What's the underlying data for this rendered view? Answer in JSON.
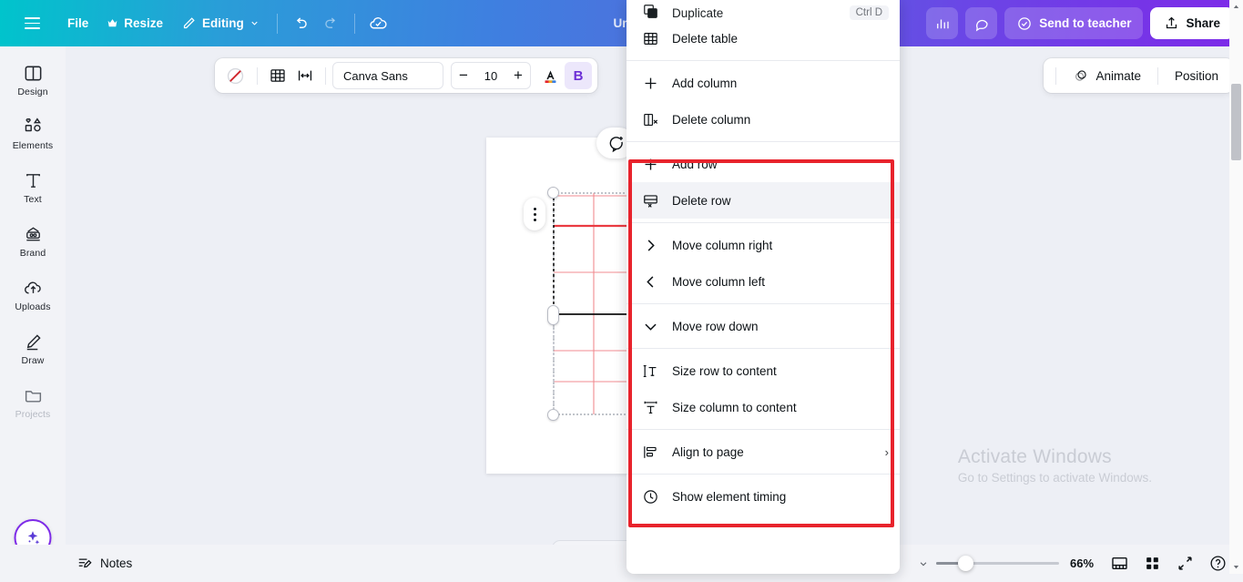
{
  "topbar": {
    "menu_icon": "hamburger-icon",
    "file_label": "File",
    "resize_label": "Resize",
    "resize_icon": "crown-icon",
    "editing_label": "Editing",
    "editing_icon": "pencil-icon",
    "chevron": "⌄",
    "undo_icon": "undo-icon",
    "redo_icon": "redo-icon",
    "cloud_icon": "cloud-check-icon",
    "design_title": "Un",
    "chart_icon": "bar-chart-icon",
    "comment_icon": "comment-icon",
    "send_label": "Send to teacher",
    "send_icon": "check-circle-icon",
    "share_label": "Share",
    "share_icon": "share-upload-icon"
  },
  "sidebar": {
    "items": [
      {
        "label": "Design",
        "icon": "design-panel-icon"
      },
      {
        "label": "Elements",
        "icon": "shapes-icon"
      },
      {
        "label": "Text",
        "icon": "text-T-icon"
      },
      {
        "label": "Brand",
        "icon": "brand-stamp-icon"
      },
      {
        "label": "Uploads",
        "icon": "cloud-upload-icon"
      },
      {
        "label": "Draw",
        "icon": "pen-draw-icon"
      },
      {
        "label": "Projects",
        "icon": "folder-icon"
      }
    ],
    "magic_icon": "magic-sparkle-icon"
  },
  "toolbar": {
    "color_swatch_icon": "no-color-slash-icon",
    "table_icon": "table-grid-icon",
    "cell_width_icon": "cell-width-icon",
    "font_family": "Canva Sans",
    "font_size": "10",
    "minus_label": "−",
    "plus_label": "+",
    "text_color_icon": "font-color-A-icon",
    "bold_label": "B",
    "animate_label": "Animate",
    "animate_icon": "animate-circle-icon",
    "position_label": "Position"
  },
  "canvas": {
    "comment_fab_icon": "add-comment-icon",
    "dots_fab_icon": "more-options-icon",
    "add_page_plus": "+"
  },
  "context_menu": {
    "items": [
      {
        "label": "Duplicate",
        "icon": "duplicate-icon",
        "shortcut": "Ctrl D",
        "clipped": true
      },
      {
        "label": "Delete table",
        "icon": "table-grid-icon"
      },
      {
        "divider": true
      },
      {
        "label": "Add column",
        "icon": "plus-icon"
      },
      {
        "label": "Delete column",
        "icon": "delete-column-icon"
      },
      {
        "divider": true
      },
      {
        "label": "Add row",
        "icon": "plus-icon"
      },
      {
        "label": "Delete row",
        "icon": "delete-row-icon",
        "highlighted": true
      },
      {
        "divider": true
      },
      {
        "label": "Move column right",
        "icon": "chevron-right-icon"
      },
      {
        "label": "Move column left",
        "icon": "chevron-left-icon"
      },
      {
        "divider": true
      },
      {
        "label": "Move row down",
        "icon": "chevron-down-icon"
      },
      {
        "divider": true
      },
      {
        "label": "Size row to content",
        "icon": "size-row-icon"
      },
      {
        "label": "Size column to content",
        "icon": "size-column-icon"
      },
      {
        "divider": true
      },
      {
        "label": "Align to page",
        "icon": "align-page-icon",
        "arrow": "›"
      },
      {
        "divider": true
      },
      {
        "label": "Show element timing",
        "icon": "clock-icon"
      }
    ],
    "highlight_box_color": "#e8232c"
  },
  "bottombar": {
    "notes_label": "Notes",
    "notes_icon": "notes-pencil-icon",
    "zoom_percent": "66%",
    "page_view_icon": "page-view-icon",
    "grid_view_icon": "grid-view-icon",
    "fullscreen_icon": "fullscreen-icon",
    "help_icon": "help-question-icon",
    "caret_icon": "caret-down-icon"
  },
  "watermark": {
    "line1": "Activate Windows",
    "line2": "Go to Settings to activate Windows."
  }
}
